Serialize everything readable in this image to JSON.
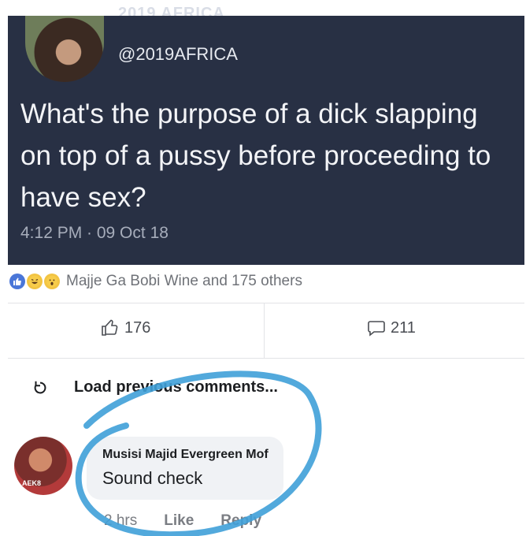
{
  "tweet": {
    "header_cut_text": "2019 AFRICA",
    "handle": "@2019AFRICA",
    "text": "What's the purpose of a dick slapping on top of a pussy before proceeding to have sex?",
    "timestamp": "4:12 PM · 09 Oct 18",
    "background_color": "#283044"
  },
  "reactions": {
    "icons": [
      "like-icon",
      "haha-icon",
      "wow-icon"
    ],
    "summary": "Majje Ga Bobi Wine and 175 others"
  },
  "actions": {
    "likes": "176",
    "comments": "211"
  },
  "comments_section": {
    "load_label": "Load previous comments...",
    "comment": {
      "avatar_tag": "AEK8",
      "author": "Musisi Majid Evergreen Mof",
      "text": "Sound check",
      "time": "2 hrs",
      "like_label": "Like",
      "reply_label": "Reply"
    },
    "highlight_color": "#3fa0d8"
  }
}
